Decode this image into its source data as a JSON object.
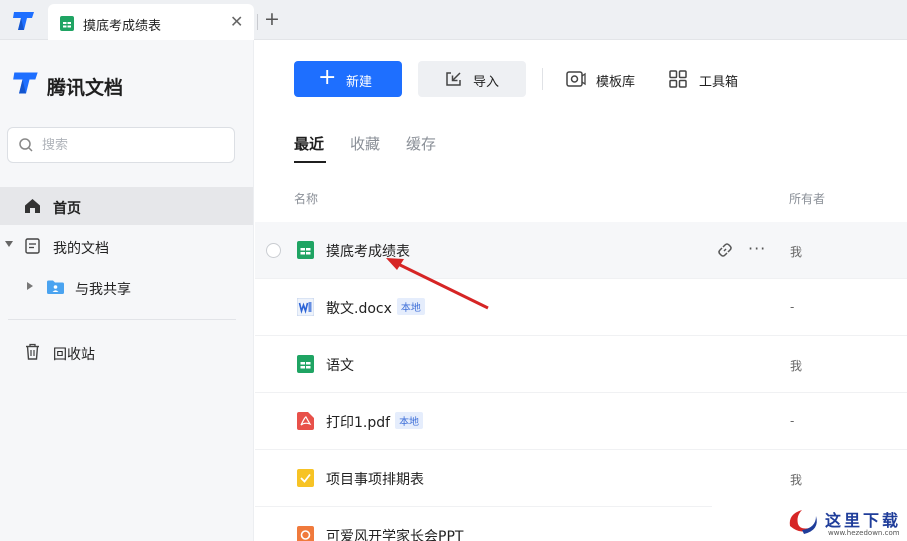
{
  "tabbar": {
    "doc_tab_label": "摸底考成绩表",
    "close_glyph": "✕",
    "add_glyph": "+"
  },
  "sidebar": {
    "brand_name": "腾讯文档",
    "search_placeholder": "搜索",
    "items": [
      {
        "label": "首页",
        "icon": "home-icon"
      },
      {
        "label": "我的文档",
        "icon": "document-icon"
      },
      {
        "label": "与我共享",
        "icon": "shared-folder-icon"
      },
      {
        "label": "回收站",
        "icon": "trash-icon"
      }
    ]
  },
  "toolbar": {
    "new_label": "新建",
    "import_label": "导入",
    "template_label": "模板库",
    "tools_label": "工具箱"
  },
  "file_tabs": [
    "最近",
    "收藏",
    "缓存"
  ],
  "columns": {
    "name": "名称",
    "owner": "所有者"
  },
  "files": [
    {
      "name": "摸底考成绩表",
      "badge": "",
      "owner": "我",
      "icon": "sheet-icon"
    },
    {
      "name": "散文.docx",
      "badge": "本地",
      "owner": "-",
      "icon": "word-icon"
    },
    {
      "name": "语文",
      "badge": "",
      "owner": "我",
      "icon": "sheet-icon"
    },
    {
      "name": "打印1.pdf",
      "badge": "本地",
      "owner": "-",
      "icon": "pdf-icon"
    },
    {
      "name": "项目事项排期表",
      "badge": "",
      "owner": "我",
      "icon": "smartsheet-icon"
    },
    {
      "name": "可爱风开学家长会PPT",
      "badge": "",
      "owner": "",
      "icon": "ppt-icon"
    }
  ],
  "watermark": {
    "text": "这里下载",
    "url": "www.hezedown.com"
  },
  "colors": {
    "accent": "#1e6fff",
    "sheet_green": "#1fa463",
    "pdf_red": "#e8514a",
    "annotation_red": "#d62525"
  }
}
